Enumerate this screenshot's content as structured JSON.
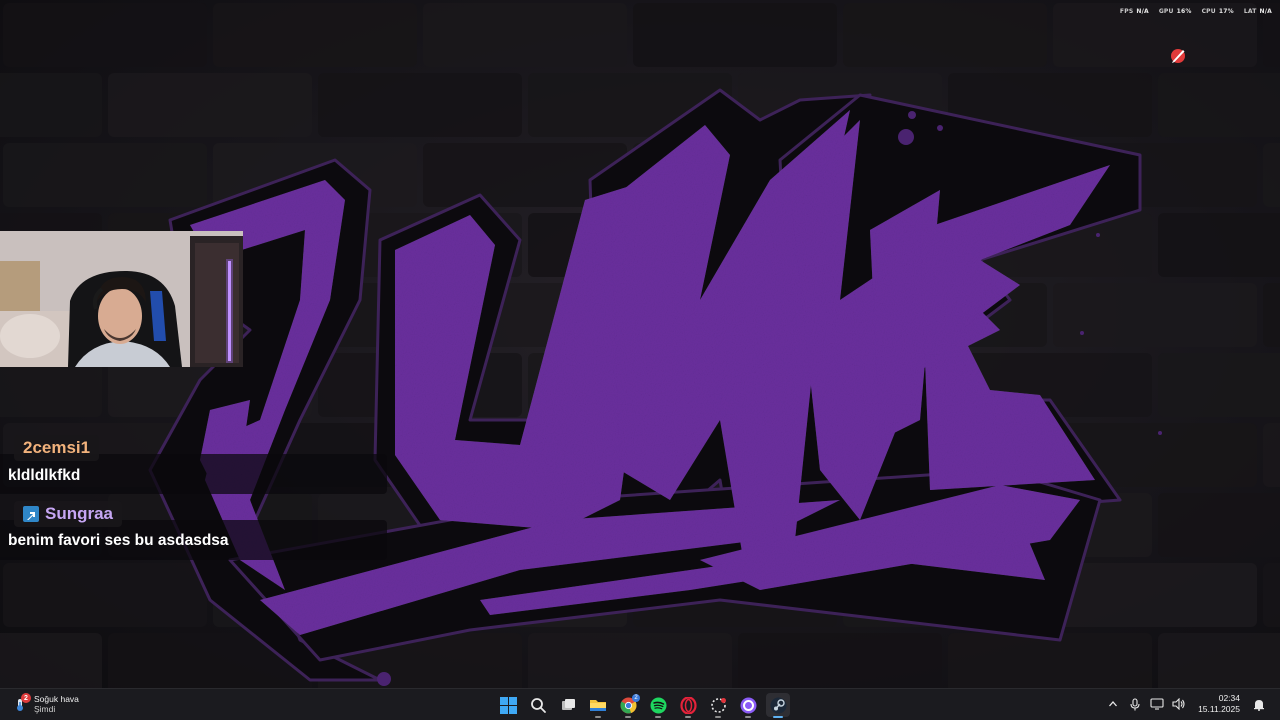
{
  "perf_overlay": {
    "fps_label": "FPS",
    "fps_value": "N/A",
    "gpu_label": "GPU",
    "gpu_value": "16%",
    "cpu_label": "CPU",
    "cpu_value": "17%",
    "lat_label": "LAT",
    "lat_value": "N/A"
  },
  "wallpaper": {
    "logo_text": "JUNKIE",
    "logo_color": "#6a2f9e"
  },
  "chat": {
    "messages": [
      {
        "username": "2cemsi1",
        "username_color": "#f2b27c",
        "text": "kldldlkfkd",
        "badge": null
      },
      {
        "username": "Sungraa",
        "username_color": "#c6a6f3",
        "text": "benim favori ses bu asdasdsa",
        "badge": "blue-badge-icon"
      }
    ]
  },
  "taskbar": {
    "weather": {
      "title": "Soğuk hava",
      "subtitle": "Şimdi",
      "notification_count": "2"
    },
    "apps": [
      {
        "name": "start",
        "icon": "windows-logo-icon"
      },
      {
        "name": "search",
        "icon": "search-icon"
      },
      {
        "name": "task-view",
        "icon": "task-view-icon"
      },
      {
        "name": "file-explorer",
        "icon": "folder-icon"
      },
      {
        "name": "chrome",
        "icon": "chrome-icon",
        "badge": "2"
      },
      {
        "name": "spotify",
        "icon": "spotify-icon"
      },
      {
        "name": "opera-gx",
        "icon": "opera-icon"
      },
      {
        "name": "app-dotted",
        "icon": "dotted-circle-icon"
      },
      {
        "name": "app-purple",
        "icon": "purple-ring-icon"
      },
      {
        "name": "steam",
        "icon": "steam-icon"
      }
    ],
    "clock": {
      "time": "02:34",
      "date": "15.11.2025"
    }
  }
}
